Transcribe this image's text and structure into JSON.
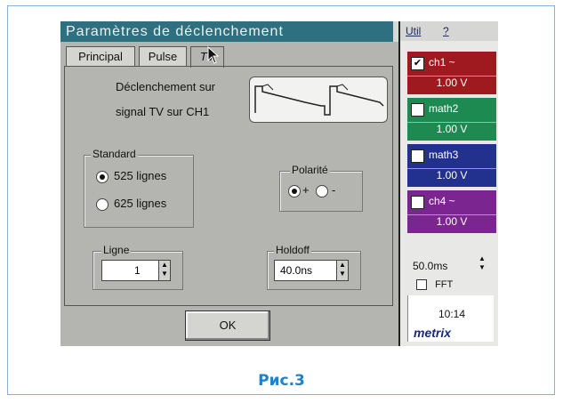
{
  "dialog": {
    "title": "Paramètres de déclenchement",
    "tabs": [
      {
        "label": "Principal"
      },
      {
        "label": "Pulse"
      },
      {
        "label": "TV"
      }
    ],
    "description_line1": "Déclenchement sur",
    "description_line2": "signal TV sur CH1",
    "standard": {
      "label": "Standard",
      "options": [
        "525 lignes",
        "625 lignes"
      ],
      "selected": "525 lignes"
    },
    "polarity": {
      "label": "Polarité",
      "plus": "+",
      "minus": "-",
      "selected": "+"
    },
    "line": {
      "label": "Ligne",
      "value": "1"
    },
    "holdoff": {
      "label": "Holdoff",
      "value": "40.0ns"
    },
    "ok_label": "OK"
  },
  "side": {
    "menu": {
      "item1": "Util",
      "item2": "?"
    },
    "channels": [
      {
        "name": "ch1 ~",
        "volt": "1.00 V",
        "checked": true,
        "color": "#9e1a1e"
      },
      {
        "name": "math2",
        "volt": "1.00 V",
        "checked": false,
        "color": "#1d8a52"
      },
      {
        "name": "math3",
        "volt": "1.00 V",
        "checked": false,
        "color": "#23318e"
      },
      {
        "name": "ch4 ~",
        "volt": "1.00 V",
        "checked": false,
        "color": "#7a2590"
      }
    ],
    "timebase": "50.0ms",
    "fft_label": "FFT",
    "clock": "10:14",
    "brand": "metrix"
  },
  "caption": "Рис.3",
  "colors": {
    "titlebar": "#2e6f80",
    "caption": "#2080c8"
  }
}
